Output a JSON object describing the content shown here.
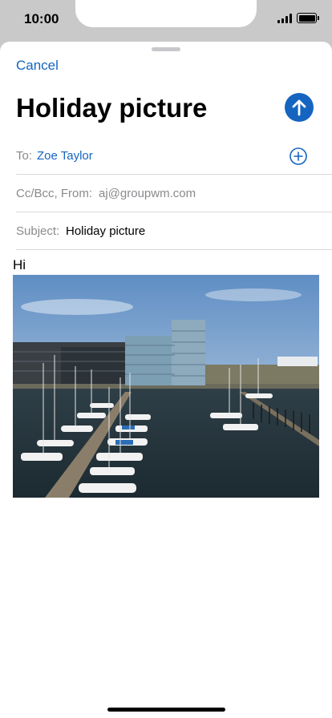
{
  "status_bar": {
    "time": "10:00"
  },
  "compose": {
    "cancel_label": "Cancel",
    "title": "Holiday picture",
    "send_icon": "arrow-up-icon",
    "to": {
      "label": "To:",
      "value": "Zoe Taylor",
      "add_icon": "plus-circle-icon"
    },
    "cc": {
      "label": "Cc/Bcc, From:",
      "value": "aj@groupwm.com"
    },
    "subject": {
      "label": "Subject:",
      "value": "Holiday picture"
    },
    "body_text": "Hi",
    "attachment": "photo"
  },
  "colors": {
    "accent": "#1565c0",
    "secondary_text": "#8a8a8e",
    "separator": "#d9d9d9"
  }
}
